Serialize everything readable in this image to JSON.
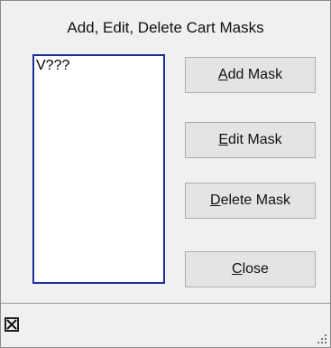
{
  "dialog": {
    "title": "Add, Edit, Delete Cart Masks"
  },
  "mask_list": {
    "items": [
      "V???"
    ]
  },
  "buttons": {
    "add": {
      "mnemonic": "A",
      "rest": "dd Mask"
    },
    "edit": {
      "mnemonic": "E",
      "rest": "dit Mask"
    },
    "delete": {
      "mnemonic": "D",
      "rest": "elete Mask"
    },
    "close": {
      "mnemonic": "C",
      "rest": "lose"
    }
  },
  "statusbar": {
    "close_icon": "close-x-icon",
    "grip_icon": "resize-grip-icon"
  },
  "colors": {
    "listbox_border": "#1c2c9b",
    "background": "#f0f0f0"
  }
}
